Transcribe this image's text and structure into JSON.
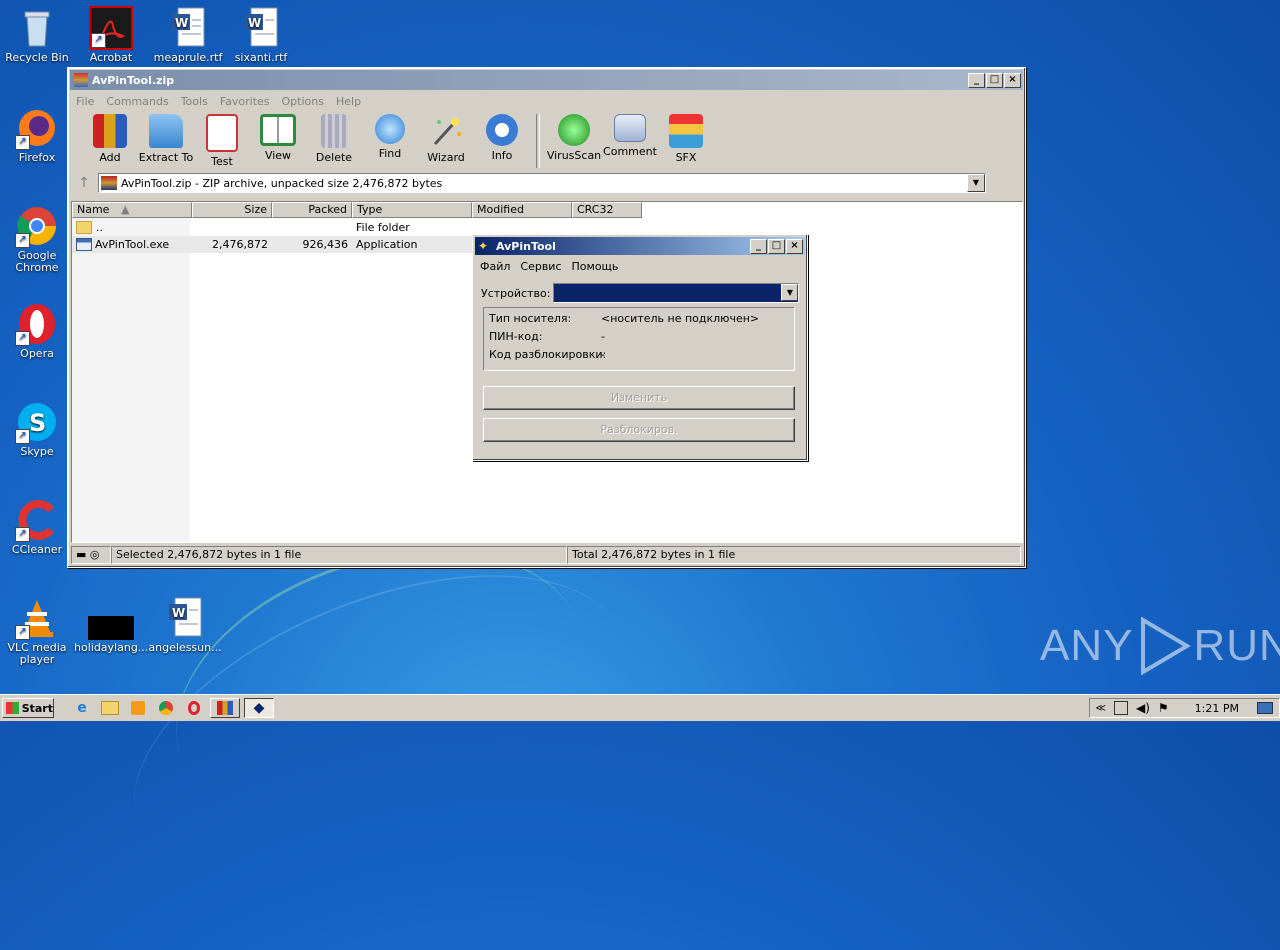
{
  "desktop_icons": [
    {
      "label": "Recycle Bin",
      "icon": "recycle-bin-icon"
    },
    {
      "label": "Acrobat",
      "icon": "acrobat-icon"
    },
    {
      "label": "meaprule.rtf",
      "icon": "word-doc-icon"
    },
    {
      "label": "sixanti.rtf",
      "icon": "word-doc-icon"
    },
    {
      "label": "Firefox",
      "icon": "firefox-icon"
    },
    {
      "label": "Google Chrome",
      "icon": "chrome-icon"
    },
    {
      "label": "Opera",
      "icon": "opera-icon"
    },
    {
      "label": "Skype",
      "icon": "skype-icon"
    },
    {
      "label": "CCleaner",
      "icon": "ccleaner-icon"
    },
    {
      "label": "VLC media player",
      "icon": "vlc-icon"
    },
    {
      "label": "holidaylang...",
      "icon": "black-thumbnail-icon"
    },
    {
      "label": "angelessun...",
      "icon": "word-doc-icon"
    }
  ],
  "winrar": {
    "title": "AvPinTool.zip",
    "menu": [
      "File",
      "Commands",
      "Tools",
      "Favorites",
      "Options",
      "Help"
    ],
    "toolbar": [
      "Add",
      "Extract To",
      "Test",
      "View",
      "Delete",
      "Find",
      "Wizard",
      "Info",
      "VirusScan",
      "Comment",
      "SFX"
    ],
    "address": "AvPinTool.zip - ZIP archive, unpacked size 2,476,872 bytes",
    "columns": [
      "Name",
      "Size",
      "Packed",
      "Type",
      "Modified",
      "CRC32"
    ],
    "rows": [
      {
        "name": "..",
        "size": "",
        "packed": "",
        "type": "File folder"
      },
      {
        "name": "AvPinTool.exe",
        "size": "2,476,872",
        "packed": "926,436",
        "type": "Application"
      }
    ],
    "status_left": "Selected 2,476,872 bytes in 1 file",
    "status_right": "Total 2,476,872 bytes in 1 file"
  },
  "avpintool": {
    "title": "AvPinTool",
    "menu": [
      "Файл",
      "Сервис",
      "Помощь"
    ],
    "device_label": "Устройство:",
    "device_value": "",
    "info": [
      {
        "label": "Тип носителя:",
        "value": "<носитель не подключен>"
      },
      {
        "label": "ПИН-код:",
        "value": "-"
      },
      {
        "label": "Код разблокировки:",
        "value": "-"
      }
    ],
    "btn_change": "Изменить",
    "btn_unlock": "Разблокиров."
  },
  "taskbar": {
    "start": "Start",
    "clock": "1:21 PM",
    "tray_chevron": "≪"
  },
  "watermark": {
    "left": "ANY",
    "right": "RUN"
  },
  "colors": {
    "dialog_title": "#0a246a",
    "desktop": "#1663c4",
    "combo_selected": "#0a246a"
  }
}
